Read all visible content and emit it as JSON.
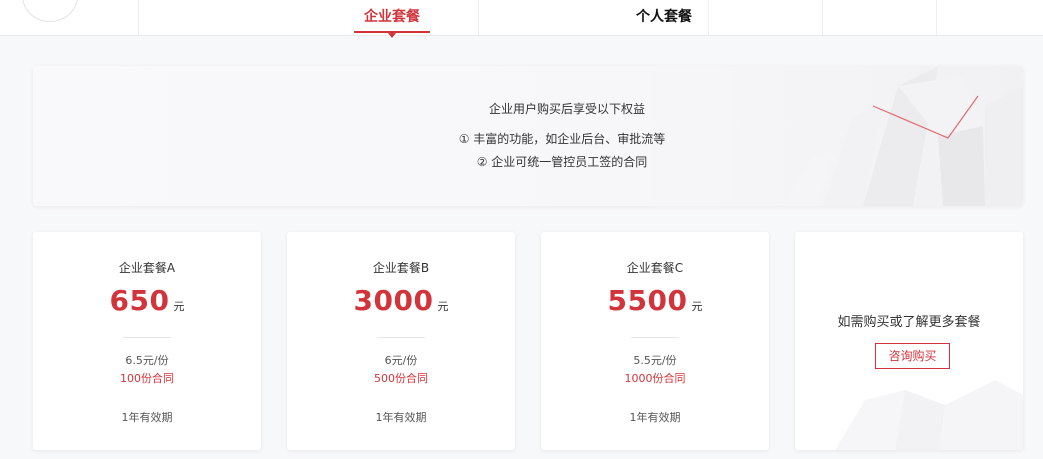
{
  "tabs": {
    "enterprise": "企业套餐",
    "personal": "个人套餐"
  },
  "benefits": {
    "title": "企业用户购买后享受以下权益",
    "items": [
      "① 丰富的功能，如企业后台、审批流等",
      "② 企业可统一管控员工签的合同"
    ]
  },
  "plans": [
    {
      "name": "企业套餐A",
      "price": "650",
      "unit": "元",
      "per_copy": "6.5元/份",
      "quantity": "100份合同",
      "validity": "1年有效期"
    },
    {
      "name": "企业套餐B",
      "price": "3000",
      "unit": "元",
      "per_copy": "6元/份",
      "quantity": "500份合同",
      "validity": "1年有效期"
    },
    {
      "name": "企业套餐C",
      "price": "5500",
      "unit": "元",
      "per_copy": "5.5元/份",
      "quantity": "1000份合同",
      "validity": "1年有效期"
    }
  ],
  "more": {
    "text": "如需购买或了解更多套餐",
    "button": "咨询购买"
  },
  "colors": {
    "accent": "#d2343b",
    "background": "#f7f8fa",
    "card": "#ffffff"
  }
}
